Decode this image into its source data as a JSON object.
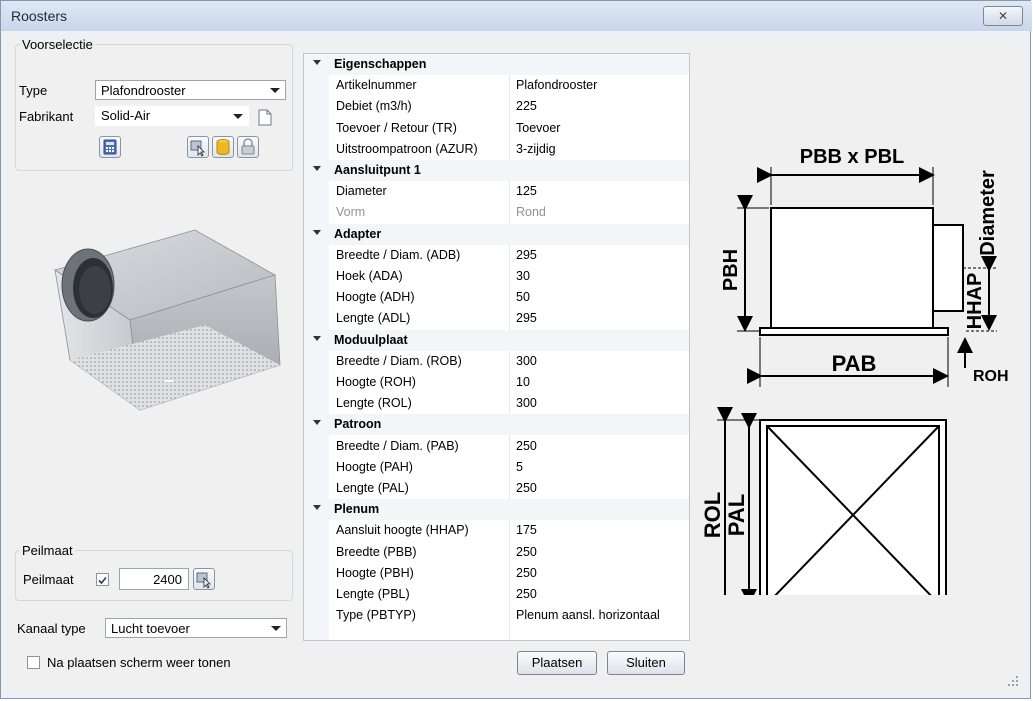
{
  "window": {
    "title": "Roosters",
    "close_glyph": "✕"
  },
  "voorselectie": {
    "legend": "Voorselectie",
    "type_label": "Type",
    "type_value": "Plafondrooster",
    "fabrikant_label": "Fabrikant",
    "fabrikant_value": "Solid-Air"
  },
  "properties": {
    "categories": [
      {
        "name": "Eigenschappen",
        "rows": [
          {
            "key": "Artikelnummer",
            "value": "Plafondrooster"
          },
          {
            "key": "Debiet (m3/h)",
            "value": "225"
          },
          {
            "key": "Toevoer / Retour (TR)",
            "value": "Toevoer"
          },
          {
            "key": "Uitstroompatroon (AZUR)",
            "value": "3-zijdig"
          }
        ]
      },
      {
        "name": "Aansluitpunt 1",
        "rows": [
          {
            "key": "Diameter",
            "value": "125"
          },
          {
            "key": "Vorm",
            "value": "Rond",
            "disabled": true
          }
        ]
      },
      {
        "name": "Adapter",
        "rows": [
          {
            "key": "Breedte / Diam. (ADB)",
            "value": "295"
          },
          {
            "key": "Hoek (ADA)",
            "value": "30"
          },
          {
            "key": "Hoogte (ADH)",
            "value": "50"
          },
          {
            "key": "Lengte (ADL)",
            "value": "295"
          }
        ]
      },
      {
        "name": "Moduulplaat",
        "rows": [
          {
            "key": "Breedte / Diam. (ROB)",
            "value": "300"
          },
          {
            "key": "Hoogte (ROH)",
            "value": "10"
          },
          {
            "key": "Lengte (ROL)",
            "value": "300"
          }
        ]
      },
      {
        "name": "Patroon",
        "rows": [
          {
            "key": "Breedte / Diam. (PAB)",
            "value": "250"
          },
          {
            "key": "Hoogte (PAH)",
            "value": "5"
          },
          {
            "key": "Lengte (PAL)",
            "value": "250"
          }
        ]
      },
      {
        "name": "Plenum",
        "rows": [
          {
            "key": "Aansluit hoogte (HHAP)",
            "value": "175"
          },
          {
            "key": "Breedte (PBB)",
            "value": "250"
          },
          {
            "key": "Hoogte (PBH)",
            "value": "250"
          },
          {
            "key": "Lengte (PBL)",
            "value": "250"
          },
          {
            "key": "Type (PBTYP)",
            "value": "Plenum aansl. horizontaal"
          }
        ]
      }
    ]
  },
  "peilmaat": {
    "legend": "Peilmaat",
    "label": "Peilmaat",
    "checked": true,
    "value": "2400"
  },
  "kanaal": {
    "label": "Kanaal type",
    "value": "Lucht toevoer"
  },
  "na_plaatsen": {
    "label": "Na plaatsen scherm weer tonen",
    "checked": false
  },
  "buttons": {
    "plaatsen": "Plaatsen",
    "sluiten": "Sluiten"
  },
  "diagram": {
    "top_dim": "PBB x PBL",
    "left_dim": "PBH",
    "right_dim": "Diameter",
    "hhap": "HHAP",
    "bottom_dim": "PAB",
    "roh": "ROH",
    "rol": "ROL",
    "pal": "PAL"
  }
}
